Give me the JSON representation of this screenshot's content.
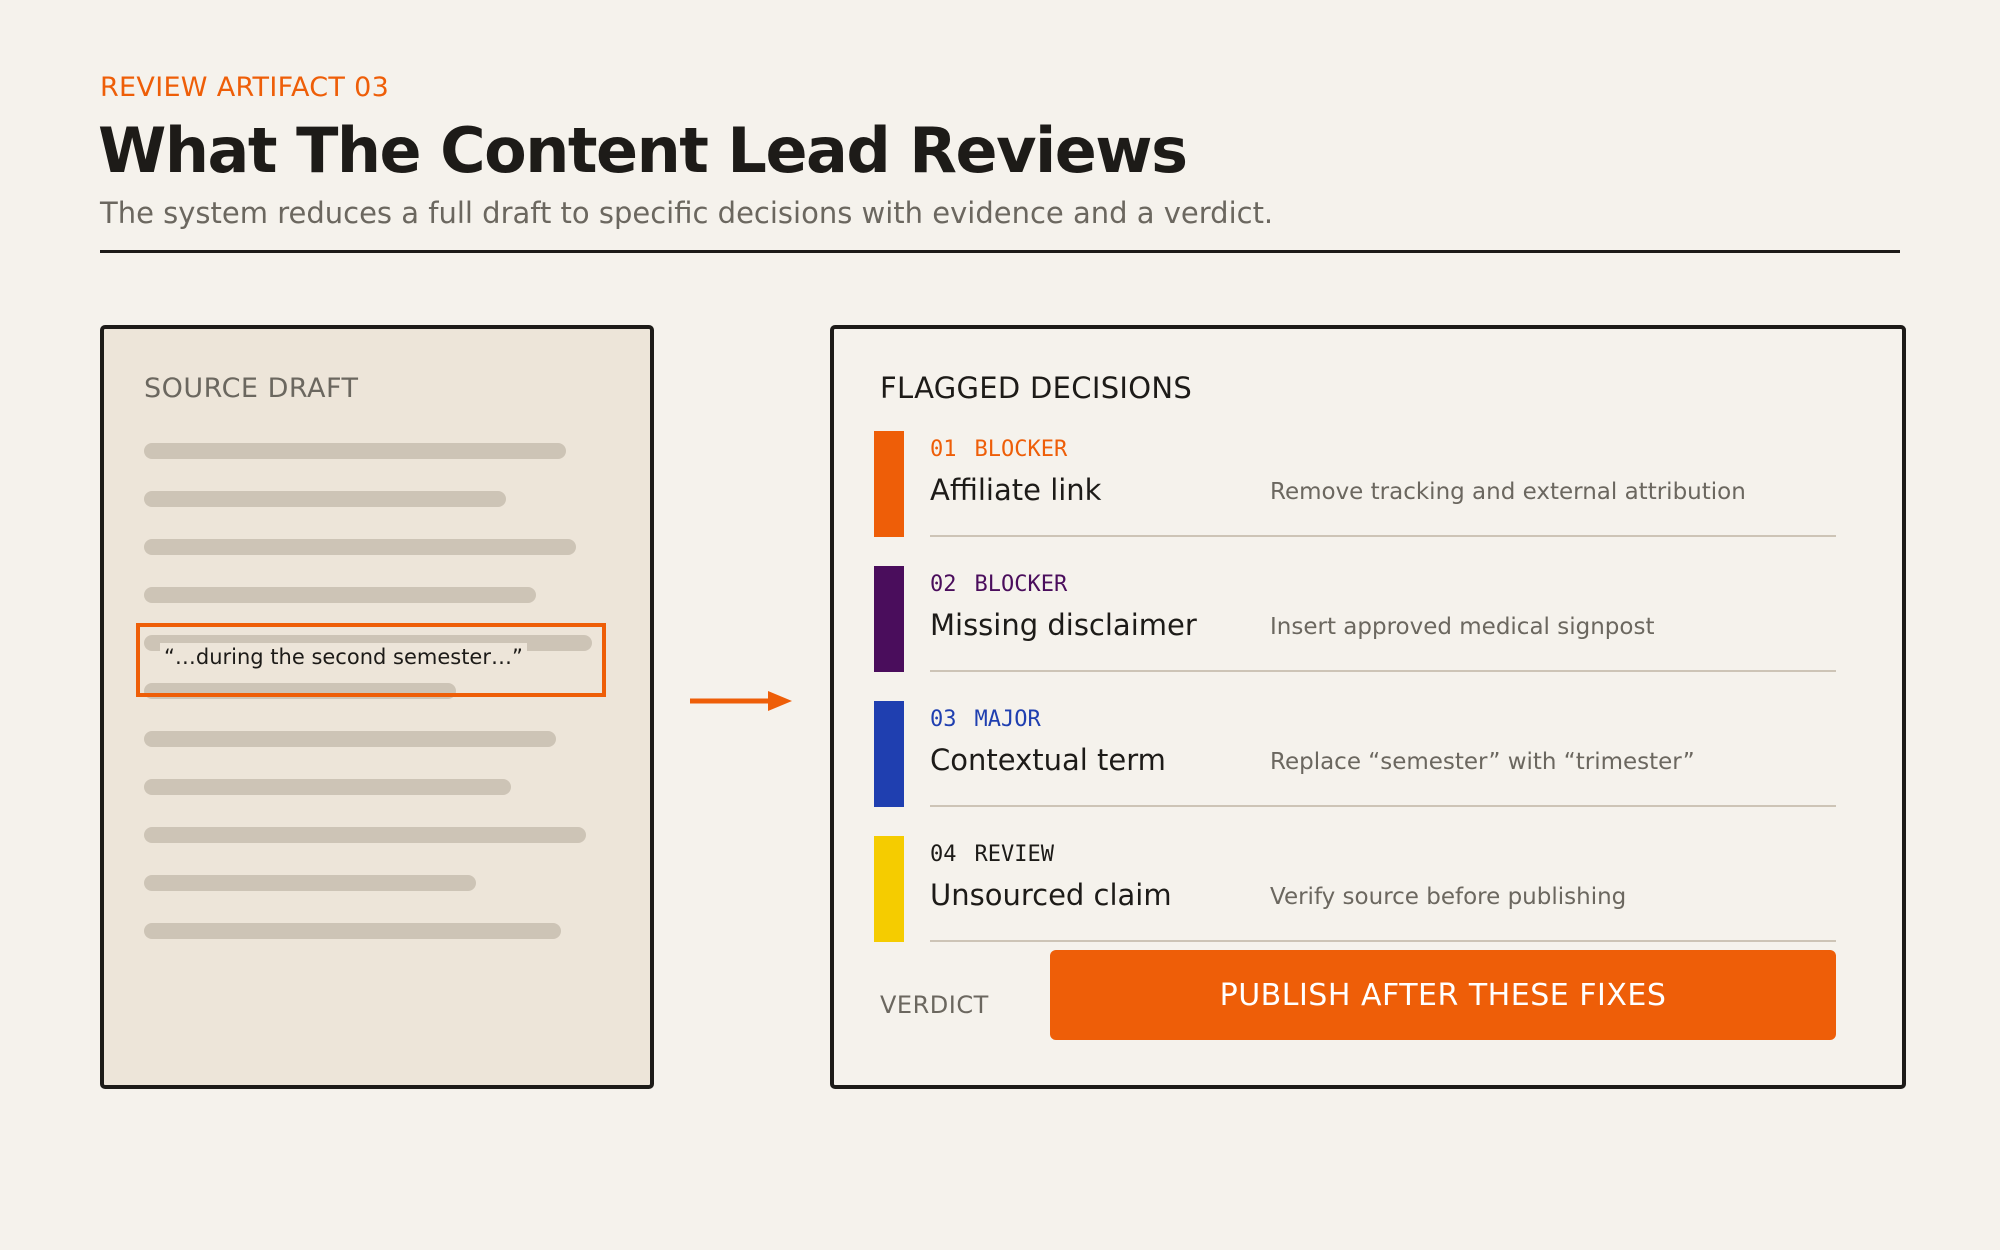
{
  "header": {
    "eyebrow": "REVIEW ARTIFACT 03",
    "title": "What The Content Lead Reviews",
    "subtitle": "The system reduces a full draft to specific decisions with evidence and a verdict."
  },
  "source_draft": {
    "label": "SOURCE DRAFT",
    "quote": "“…during the second semester…”"
  },
  "flagged": {
    "label": "FLAGGED DECISIONS",
    "items": [
      {
        "number": "01",
        "severity": "BLOCKER",
        "title": "Affiliate link",
        "action": "Remove tracking and external attribution",
        "color": "#ee5e08"
      },
      {
        "number": "02",
        "severity": "BLOCKER",
        "title": "Missing disclaimer",
        "action": "Insert approved medical signpost",
        "color": "#4a0d5c"
      },
      {
        "number": "03",
        "severity": "MAJOR",
        "title": "Contextual term",
        "action": "Replace “semester” with “trimester”",
        "color": "#1f3fb0"
      },
      {
        "number": "04",
        "severity": "REVIEW",
        "title": "Unsourced claim",
        "action": "Verify source before publishing",
        "color": "#f5cc00"
      }
    ],
    "verdict_label": "VERDICT",
    "verdict": "PUBLISH AFTER THESE FIXES"
  },
  "colors": {
    "accent": "#ee5e08",
    "background": "#f5f2ec",
    "draft_background": "#ede5d9",
    "text_lines": "#cdc4b6"
  }
}
